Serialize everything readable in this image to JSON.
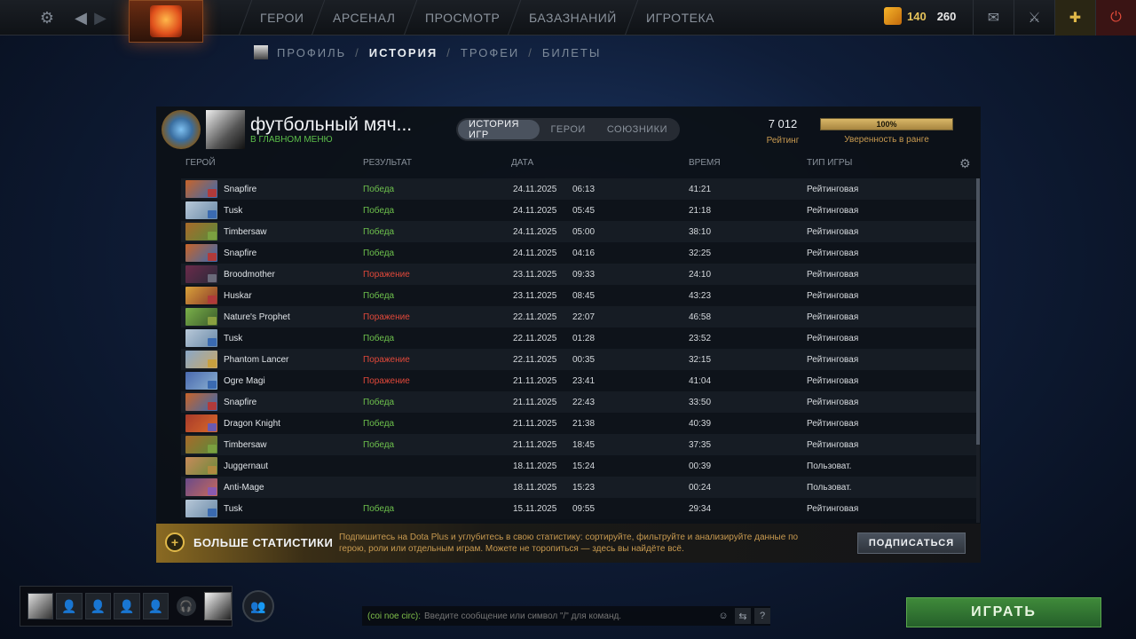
{
  "nav": {
    "items": [
      "ГЕРОИ",
      "АРСЕНАЛ",
      "ПРОСМОТР",
      "БАЗАЗНАНИЙ",
      "ИГРОТЕКА"
    ],
    "shards": "140",
    "level": "260"
  },
  "subnav": {
    "items": [
      "ПРОФИЛЬ",
      "ИСТОРИЯ",
      "ТРОФЕИ",
      "БИЛЕТЫ"
    ],
    "active": "ИСТОРИЯ"
  },
  "profile": {
    "name": "футбольный мяч...",
    "status": "В ГЛАВНОМ МЕНЮ",
    "rating_value": "7 012",
    "rating_label": "Рейтинг",
    "confidence_value": "100%",
    "confidence_fraction": 1.0,
    "confidence_label": "Уверенность в ранге"
  },
  "tabs": [
    "ИСТОРИЯ ИГР",
    "ГЕРОИ",
    "СОЮЗНИКИ"
  ],
  "table": {
    "headers": {
      "hero": "ГЕРОЙ",
      "result": "РЕЗУЛЬТАТ",
      "date": "ДАТА",
      "duration": "ВРЕМЯ",
      "type": "ТИП ИГРЫ"
    },
    "rows": [
      {
        "hero": "Snapfire",
        "result": "Победа",
        "outcome": "win",
        "date": "24.11.2025",
        "time": "06:13",
        "duration": "41:21",
        "type": "Рейтинговая"
      },
      {
        "hero": "Tusk",
        "result": "Победа",
        "outcome": "win",
        "date": "24.11.2025",
        "time": "05:45",
        "duration": "21:18",
        "type": "Рейтинговая"
      },
      {
        "hero": "Timbersaw",
        "result": "Победа",
        "outcome": "win",
        "date": "24.11.2025",
        "time": "05:00",
        "duration": "38:10",
        "type": "Рейтинговая"
      },
      {
        "hero": "Snapfire",
        "result": "Победа",
        "outcome": "win",
        "date": "24.11.2025",
        "time": "04:16",
        "duration": "32:25",
        "type": "Рейтинговая"
      },
      {
        "hero": "Broodmother",
        "result": "Поражение",
        "outcome": "loss",
        "date": "23.11.2025",
        "time": "09:33",
        "duration": "24:10",
        "type": "Рейтинговая"
      },
      {
        "hero": "Huskar",
        "result": "Победа",
        "outcome": "win",
        "date": "23.11.2025",
        "time": "08:45",
        "duration": "43:23",
        "type": "Рейтинговая"
      },
      {
        "hero": "Nature's Prophet",
        "result": "Поражение",
        "outcome": "loss",
        "date": "22.11.2025",
        "time": "22:07",
        "duration": "46:58",
        "type": "Рейтинговая"
      },
      {
        "hero": "Tusk",
        "result": "Победа",
        "outcome": "win",
        "date": "22.11.2025",
        "time": "01:28",
        "duration": "23:52",
        "type": "Рейтинговая"
      },
      {
        "hero": "Phantom Lancer",
        "result": "Поражение",
        "outcome": "loss",
        "date": "22.11.2025",
        "time": "00:35",
        "duration": "32:15",
        "type": "Рейтинговая"
      },
      {
        "hero": "Ogre Magi",
        "result": "Поражение",
        "outcome": "loss",
        "date": "21.11.2025",
        "time": "23:41",
        "duration": "41:04",
        "type": "Рейтинговая"
      },
      {
        "hero": "Snapfire",
        "result": "Победа",
        "outcome": "win",
        "date": "21.11.2025",
        "time": "22:43",
        "duration": "33:50",
        "type": "Рейтинговая"
      },
      {
        "hero": "Dragon Knight",
        "result": "Победа",
        "outcome": "win",
        "date": "21.11.2025",
        "time": "21:38",
        "duration": "40:39",
        "type": "Рейтинговая"
      },
      {
        "hero": "Timbersaw",
        "result": "Победа",
        "outcome": "win",
        "date": "21.11.2025",
        "time": "18:45",
        "duration": "37:35",
        "type": "Рейтинговая"
      },
      {
        "hero": "Juggernaut",
        "result": "",
        "outcome": "none",
        "date": "18.11.2025",
        "time": "15:24",
        "duration": "00:39",
        "type": "Пользоват."
      },
      {
        "hero": "Anti-Mage",
        "result": "",
        "outcome": "none",
        "date": "18.11.2025",
        "time": "15:23",
        "duration": "00:24",
        "type": "Пользоват."
      },
      {
        "hero": "Tusk",
        "result": "Победа",
        "outcome": "win",
        "date": "15.11.2025",
        "time": "09:55",
        "duration": "29:34",
        "type": "Рейтинговая"
      }
    ]
  },
  "dotaplus": {
    "title": "БОЛЬШЕ СТАТИСТИКИ",
    "description": "Подпишитесь на Dota Plus и углубитесь в свою статистику: сортируйте, фильтруйте и анализируйте данные по герою, роли или отдельным играм. Можете не торопиться — здесь вы найдёте всё.",
    "button": "ПОДПИСАТЬСЯ"
  },
  "chat": {
    "channel": "(coi noe circ):",
    "placeholder": "Введите сообщение или символ \"/\" для команд."
  },
  "play_button": "ИГРАТЬ",
  "colors": {
    "win": "#6dc04c",
    "loss": "#e0483a",
    "accent_gold": "#c89a50",
    "play_green": "#3f8a3a"
  }
}
